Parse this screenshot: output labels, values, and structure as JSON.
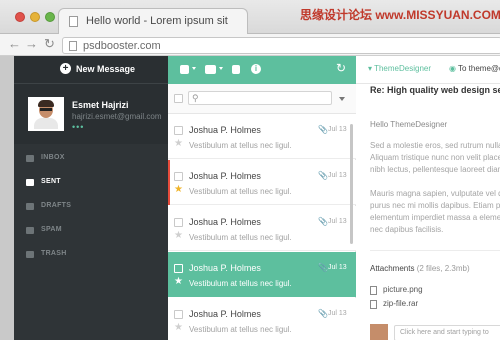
{
  "browser": {
    "tab_title": "Hello world - Lorem ipsum sit",
    "url": "psdbooster.com",
    "watermark": "思缘设计论坛 www.MISSYUAN.COM",
    "icons": [
      "back-arrow",
      "forward-arrow",
      "reload"
    ]
  },
  "sidebar": {
    "new_message_label": "New Message",
    "profile": {
      "name": "Esmet Hajrizi",
      "email": "hajrizi.esmet@gmail.com",
      "status": "•••"
    },
    "items": [
      {
        "label": "INBOX",
        "icon": "inbox-icon"
      },
      {
        "label": "SENT",
        "icon": "send-icon",
        "active": true
      },
      {
        "label": "DRAFTS",
        "icon": "drafts-icon"
      },
      {
        "label": "SPAM",
        "icon": "spam-icon"
      },
      {
        "label": "TRASH",
        "icon": "trash-icon"
      }
    ]
  },
  "list": {
    "toolbar_icons": [
      "inbox-icon",
      "folder-icon",
      "trash-icon",
      "info-icon",
      "refresh-icon"
    ],
    "rows": [
      {
        "sender": "Joshua P. Holmes",
        "snippet": "Vestibulum at tellus nec ligul.",
        "date": "Jul 13",
        "attachment": true,
        "starred": false,
        "flagged": false,
        "selected": false
      },
      {
        "sender": "Joshua P. Holmes",
        "snippet": "Vestibulum at tellus nec ligul.",
        "date": "Jul 13",
        "attachment": true,
        "starred": true,
        "flagged": true,
        "selected": false
      },
      {
        "sender": "Joshua P. Holmes",
        "snippet": "Vestibulum at tellus nec ligul.",
        "date": "Jul 13",
        "attachment": true,
        "starred": false,
        "flagged": false,
        "selected": false
      },
      {
        "sender": "Joshua P. Holmes",
        "snippet": "Vestibulum at tellus nec ligul.",
        "date": "Jul 13",
        "attachment": true,
        "starred": false,
        "flagged": false,
        "selected": true
      },
      {
        "sender": "Joshua P. Holmes",
        "snippet": "Vestibulum at tellus nec ligul.",
        "date": "Jul 13",
        "attachment": true,
        "starred": false,
        "flagged": false,
        "selected": false
      }
    ]
  },
  "reader": {
    "from": "ThemeDesigner",
    "to": "To theme@d",
    "subject": "Re: High quality web design servic",
    "greeting": "Hello ThemeDesigner",
    "para1": [
      "Sed a molestie eros, sed rutrum nulla. Pr",
      "Aliquam tristique nunc non velit placer",
      "nibh lectus, pellentesque laoreet diam"
    ],
    "para2": [
      "Mauris magna sapien, vulputate vel do",
      "purus nec mi mollis dapibus. Etiam p",
      "elementum imperdiet massa a elemen",
      "nec dapibus facilisis."
    ],
    "attachments_label": "Attachments",
    "attachments_meta": "(2 files, 2.3mb)",
    "files": [
      "picture.png",
      "zip-file.rar"
    ],
    "reply_placeholder": "Click here and start typing to"
  },
  "colors": {
    "accent": "#5dbf9e",
    "sidebar_bg": "#2f3437",
    "flag": "#e74c3c",
    "star": "#f0b429"
  }
}
